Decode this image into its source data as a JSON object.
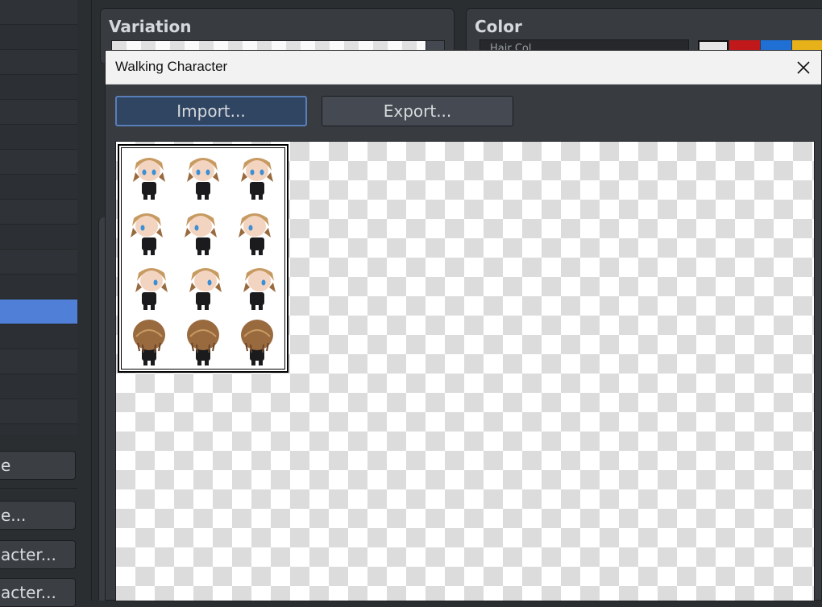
{
  "background": {
    "variation_panel": {
      "title": "Variation"
    },
    "color_panel": {
      "title": "Color",
      "field_text": "Hair Col...",
      "swatches": [
        "#e6e6e6",
        "#c0181b",
        "#1f6fd4",
        "#e7b11a"
      ]
    },
    "left_buttons": [
      {
        "label": "e"
      },
      {
        "label": "e..."
      },
      {
        "label": "acter..."
      },
      {
        "label": "acter..."
      }
    ]
  },
  "dialog": {
    "title": "Walking Character",
    "close_icon": "close-icon",
    "import_label": "Import...",
    "export_label": "Export..."
  },
  "sprite_sheet": {
    "rows": 4,
    "cols": 3,
    "directions": [
      "down",
      "left",
      "right",
      "up"
    ],
    "colors": {
      "hair": "#9a6a3f",
      "hair_light": "#c79a62",
      "outfit": "#1b1b1d",
      "skin": "#f3d4c0",
      "eye": "#3a8fd6"
    }
  }
}
